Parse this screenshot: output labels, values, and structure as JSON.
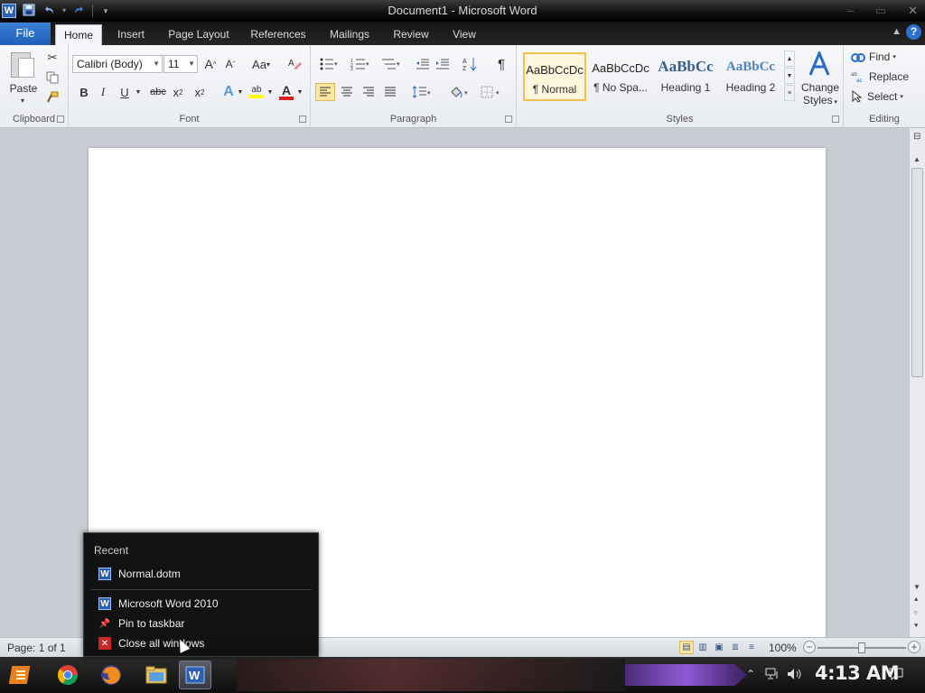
{
  "window": {
    "title": "Document1 - Microsoft Word",
    "app_logo": "W",
    "controls": [
      "minimize-icon",
      "maximize-icon",
      "close-icon"
    ]
  },
  "quick_access": {
    "icons": [
      "save-icon",
      "undo-icon",
      "redo-icon",
      "customize-icon"
    ]
  },
  "tabs": {
    "file": "File",
    "items": [
      "Home",
      "Insert",
      "Page Layout",
      "References",
      "Mailings",
      "Review",
      "View"
    ],
    "active": "Home"
  },
  "ribbon": {
    "clipboard": {
      "label": "Clipboard",
      "paste": "Paste"
    },
    "font": {
      "label": "Font",
      "family": "Calibri (Body)",
      "size": "11",
      "grow": "A",
      "shrink": "A",
      "change_case": "Aa",
      "bold": "B",
      "italic": "I",
      "underline": "U",
      "strike": "abc",
      "subscript": "x",
      "superscript": "x",
      "text_effects": "A",
      "highlight": "ab",
      "font_color": "A",
      "font_color_hex": "#e02020",
      "highlight_hex": "#ffff00"
    },
    "paragraph": {
      "label": "Paragraph",
      "show_marks": "¶"
    },
    "styles": {
      "label": "Styles",
      "tiles": [
        {
          "sample": "AaBbCcDc",
          "name": "¶ Normal"
        },
        {
          "sample": "AaBbCcDc",
          "name": "¶ No Spa..."
        },
        {
          "sample": "AaBbCc",
          "name": "Heading 1"
        },
        {
          "sample": "AaBbCc",
          "name": "Heading 2"
        }
      ],
      "change_styles": "Change",
      "change_styles_2": "Styles"
    },
    "editing": {
      "label": "Editing",
      "find": "Find",
      "replace": "Replace",
      "select": "Select"
    }
  },
  "statusbar": {
    "page_info": "Page: 1 of 1",
    "zoom": "100%",
    "zoom_minus": "−",
    "zoom_plus": "+",
    "zoom_level": 0.5
  },
  "jumplist": {
    "heading": "Recent",
    "recent": [
      "Normal.dotm"
    ],
    "tasks": [
      "Microsoft Word 2010",
      "Pin to taskbar",
      "Close all windows"
    ]
  },
  "taskbar": {
    "apps": [
      "start-icon",
      "chrome-icon",
      "firefox-icon",
      "explorer-icon",
      "word-icon"
    ],
    "clock": "4:13 AM"
  },
  "colors": {
    "file_tab": "#2a6bc6",
    "selected_style_border": "#f3c24d",
    "heading1": "#365f91",
    "heading2": "#4f81bd"
  }
}
